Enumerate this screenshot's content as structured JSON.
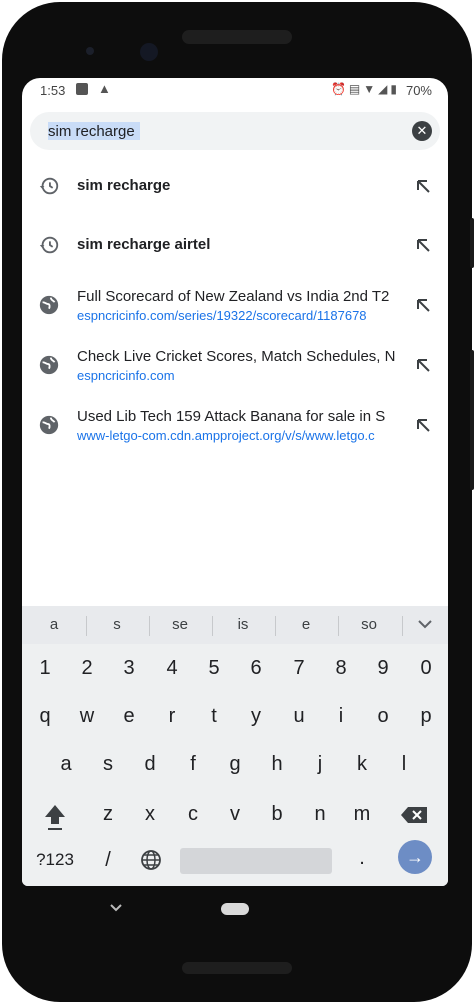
{
  "status_bar": {
    "time": "1:53",
    "battery": "70%",
    "icons": [
      "notification-square-icon",
      "warning-icon",
      "alarm-icon",
      "cast-icon",
      "signal-icon",
      "wifi-icon",
      "mobile-signal-icon",
      "battery-icon"
    ]
  },
  "search": {
    "query": "sim recharge",
    "highlighted": "sim recharge"
  },
  "suggestions": [
    {
      "type": "history",
      "title": "sim recharge",
      "url": ""
    },
    {
      "type": "history",
      "title": "sim recharge airtel",
      "url": ""
    },
    {
      "type": "web",
      "title": "Full Scorecard of New Zealand vs India 2nd T2",
      "url": "espncricinfo.com/series/19322/scorecard/1187678"
    },
    {
      "type": "web",
      "title": "Check Live Cricket Scores, Match Schedules, N",
      "url": "espncricinfo.com"
    },
    {
      "type": "web",
      "title": "Used Lib Tech 159 Attack Banana for sale in S",
      "url": "www-letgo-com.cdn.ampproject.org/v/s/www.letgo.c"
    }
  ],
  "keyboard": {
    "word_suggestions": [
      "a",
      "s",
      "se",
      "is",
      "e",
      "so"
    ],
    "number_row": [
      "1",
      "2",
      "3",
      "4",
      "5",
      "6",
      "7",
      "8",
      "9",
      "0"
    ],
    "row1": [
      "q",
      "w",
      "e",
      "r",
      "t",
      "y",
      "u",
      "i",
      "o",
      "p"
    ],
    "row2": [
      "a",
      "s",
      "d",
      "f",
      "g",
      "h",
      "j",
      "k",
      "l"
    ],
    "row3": [
      "z",
      "x",
      "c",
      "v",
      "b",
      "n",
      "m"
    ],
    "symbols_key": "?123",
    "slash_key": "/",
    "period_key": "."
  },
  "colors": {
    "accent": "#1a73e8",
    "enter_key": "#6d8dc5",
    "search_bg": "#f1f3f4",
    "keyboard_bg": "#eef0f1"
  }
}
